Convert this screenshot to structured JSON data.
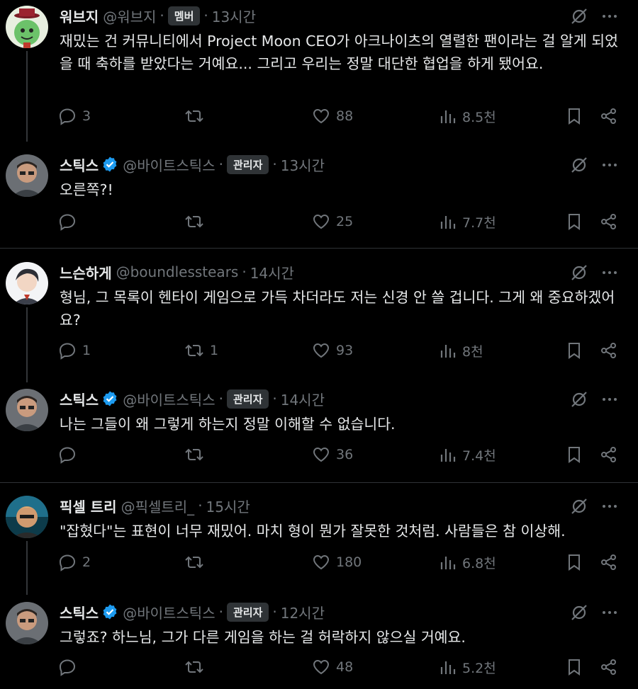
{
  "tweets": [
    {
      "name": "워브지",
      "handle": "@워브지",
      "dot": "·",
      "badge": "멤버",
      "time": "13시간",
      "text": "재밌는 건 커뮤니티에서 Project Moon CEO가 아크나이츠의 열렬한 팬이라는 걸 알게 되었을 때 축하를 받았다는 거예요... 그리고 우리는 정말 대단한 협업을 하게 됐어요.",
      "verified": false,
      "replies": "3",
      "retweets": "",
      "likes": "88",
      "views": "8.5천"
    },
    {
      "name": "스틱스",
      "handle": "@바이트스틱스",
      "dot": "·",
      "badge": "관리자",
      "time": "13시간",
      "text": "오른쪽?!",
      "verified": true,
      "replies": "",
      "retweets": "",
      "likes": "25",
      "views": "7.7천"
    },
    {
      "name": "느슨하게",
      "handle": "@boundlesstears",
      "dot": "·",
      "badge": "",
      "time": "14시간",
      "text": "형님, 그 목록이 헨타이 게임으로 가득 차더라도 저는 신경 안 쓸 겁니다. 그게 왜 중요하겠어요?",
      "verified": false,
      "replies": "1",
      "retweets": "1",
      "likes": "93",
      "views": "8천"
    },
    {
      "name": "스틱스",
      "handle": "@바이트스틱스",
      "dot": "·",
      "badge": "관리자",
      "time": "14시간",
      "text": "나는 그들이 왜 그렇게 하는지 정말 이해할 수 없습니다.",
      "verified": true,
      "replies": "",
      "retweets": "",
      "likes": "36",
      "views": "7.4천"
    },
    {
      "name": "픽셀 트리",
      "handle": "@픽셀트리_",
      "dot": "·",
      "badge": "",
      "time": "15시간",
      "text": "\"잡혔다\"는 표현이 너무 재밌어. 마치 형이 뭔가 잘못한 것처럼. 사람들은 참 이상해.",
      "verified": false,
      "replies": "2",
      "retweets": "",
      "likes": "180",
      "views": "6.8천"
    },
    {
      "name": "스틱스",
      "handle": "@바이트스틱스",
      "dot": "·",
      "badge": "관리자",
      "time": "12시간",
      "text": "그렇죠? 하느님, 그가 다른 게임을 하는 걸 허락하지 않으실 거예요.",
      "verified": true,
      "replies": "",
      "retweets": "",
      "likes": "48",
      "views": "5.2천"
    }
  ],
  "colors": {
    "bg": "#000000",
    "text": "#e7e9ea",
    "muted": "#71767b",
    "verified": "#1d9bf0",
    "badge_bg": "#2f3336"
  },
  "icons": [
    "grok-slash-icon",
    "more-icon",
    "reply-icon",
    "retweet-icon",
    "like-icon",
    "views-icon",
    "bookmark-icon",
    "share-icon"
  ]
}
